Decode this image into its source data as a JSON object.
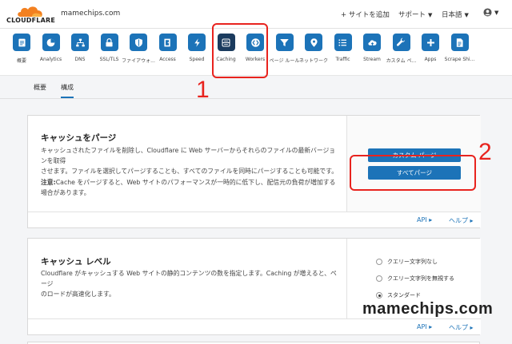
{
  "header": {
    "logo_text": "CLOUDFLARE",
    "domain": "mamechips.com",
    "add_site": "サイトを追加",
    "support": "サポート",
    "language": "日本語"
  },
  "nav_icons": [
    {
      "label": "概要",
      "icon": "overview-icon"
    },
    {
      "label": "Analytics",
      "icon": "analytics-icon"
    },
    {
      "label": "DNS",
      "icon": "dns-icon"
    },
    {
      "label": "SSL/TLS",
      "icon": "lock-icon"
    },
    {
      "label": "ファイアウォ...",
      "icon": "firewall-icon"
    },
    {
      "label": "Access",
      "icon": "access-icon"
    },
    {
      "label": "Speed",
      "icon": "lightning-icon"
    },
    {
      "label": "Caching",
      "icon": "caching-icon"
    },
    {
      "label": "Workers",
      "icon": "workers-icon"
    },
    {
      "label": "ページ ルール",
      "icon": "filter-icon"
    },
    {
      "label": "ネットワーク",
      "icon": "location-icon"
    },
    {
      "label": "Traffic",
      "icon": "list-icon"
    },
    {
      "label": "Stream",
      "icon": "cloud-upload-icon"
    },
    {
      "label": "カスタム ペ...",
      "icon": "wrench-icon"
    },
    {
      "label": "Apps",
      "icon": "plus-icon"
    },
    {
      "label": "Scrape Shi...",
      "icon": "document-icon"
    }
  ],
  "subtabs": {
    "overview": "概要",
    "config": "構成"
  },
  "purge_card": {
    "title": "キャッシュをパージ",
    "desc_line1": "キャッシュされたファイルを削除し、Cloudflare に Web サーバーからそれらのファイルの最新バージョンを取得",
    "desc_line2": "させます。ファイルを選択してパージすることも、すべてのファイルを同時にパージすることも可能です。",
    "note_label": "注意:",
    "note_line1": "Cache をパージすると、Web サイトのパフォーマンスが一時的に低下し、配信元の負荷が増加する",
    "note_line2": "場合があります。",
    "custom_purge_button": "カスタム パージ",
    "purge_all_button": "すべてパージ",
    "api_link": "API",
    "help_link": "ヘルプ"
  },
  "level_card": {
    "title": "キャッシュ レベル",
    "desc_line1": "Cloudflare がキャッシュする Web サイトの静的コンテンツの数を指定します。Caching が増えると、ページ",
    "desc_line2": "のロードが高速化します。",
    "options": [
      "クエリー文字列なし",
      "クエリー文字列を無視する",
      "スタンダード"
    ],
    "api_link": "API",
    "help_link": "ヘルプ"
  },
  "annotations": {
    "step1": "1",
    "step2": "2"
  },
  "watermark": "mamechips.com",
  "colors": {
    "brand_blue": "#1c73b8",
    "active_icon": "#1b3b5e",
    "annotation_red": "#e8231e",
    "logo_orange": "#f38020"
  }
}
